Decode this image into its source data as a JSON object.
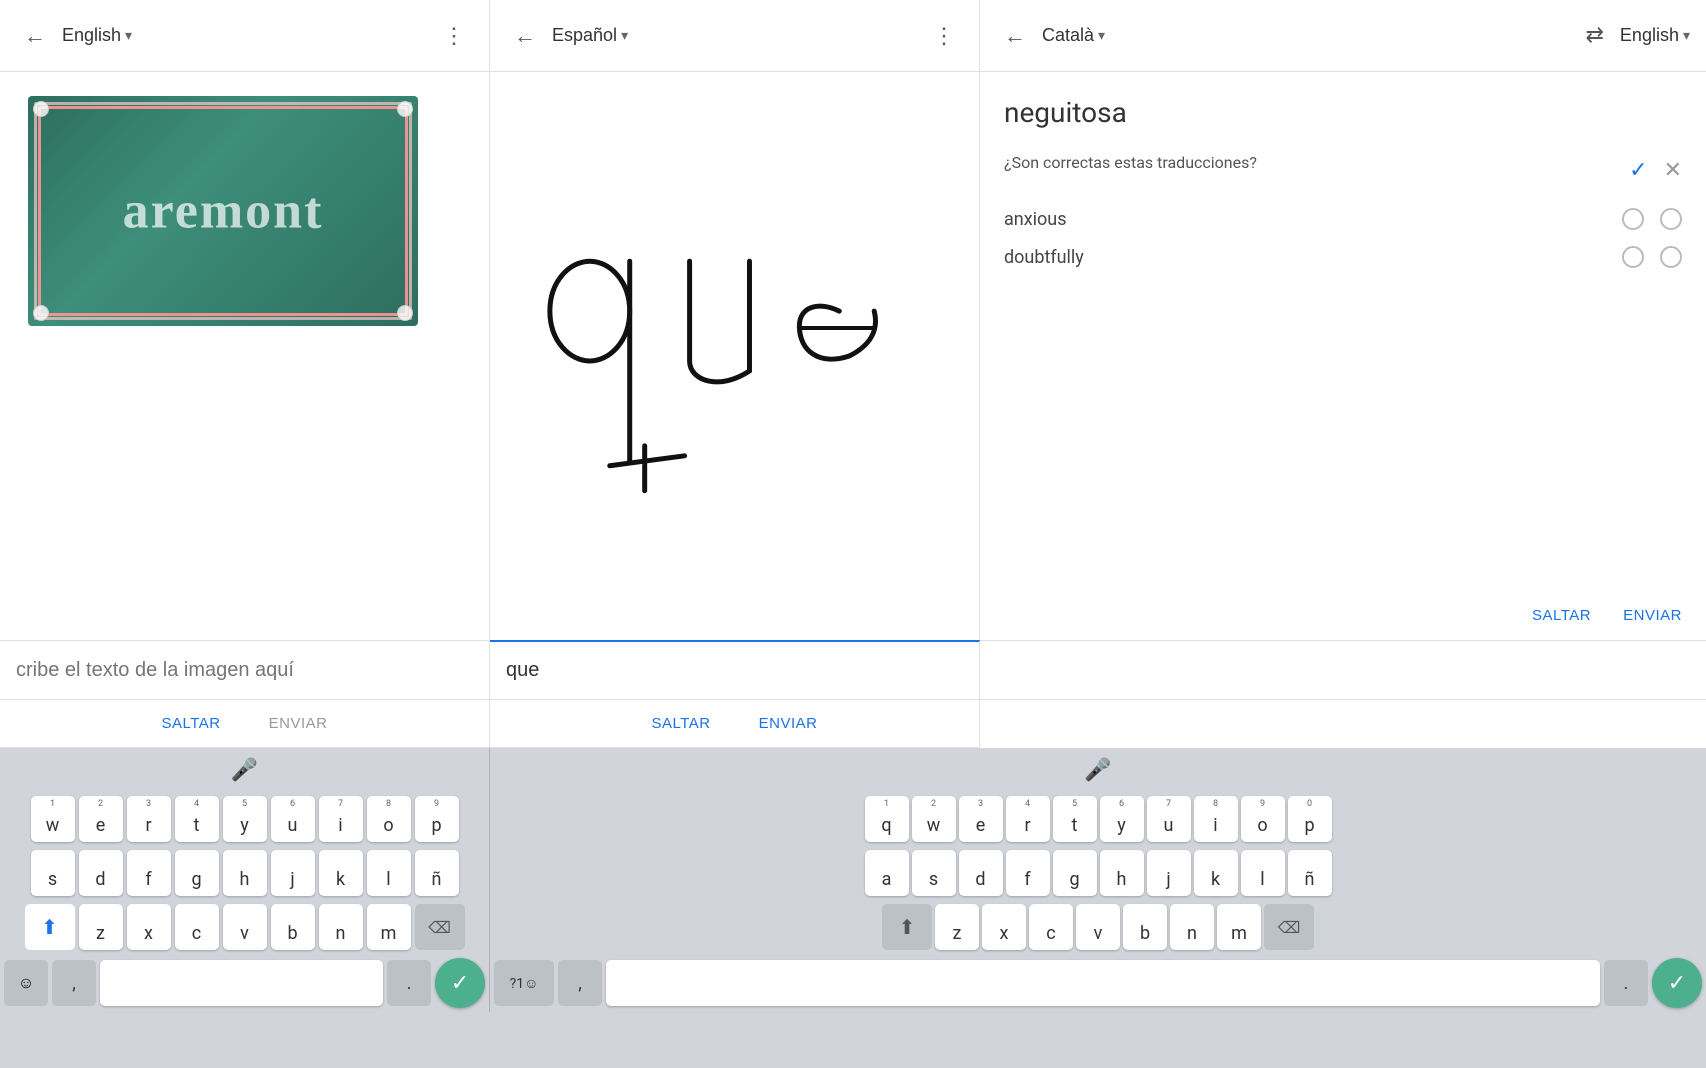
{
  "topbar": {
    "left_back_icon": "←",
    "left_lang": "English",
    "left_lang_arrow": "▾",
    "left_menu_icon": "⋮",
    "middle_back_icon": "←",
    "middle_lang": "Español",
    "middle_lang_arrow": "▾",
    "middle_menu_icon": "⋮",
    "right_back_icon": "←",
    "right_lang": "Català",
    "right_lang_arrow": "▾",
    "right_swap_icon": "⇄",
    "right_end_lang": "English",
    "right_end_lang_arrow": "▾"
  },
  "left_panel": {
    "sign_text": "aremont",
    "image_alt": "Street sign showing aremont",
    "input_placeholder": "cribe el texto de la imagen aquí",
    "skip_label": "SALTAR",
    "send_label": "ENVIAR"
  },
  "middle_panel": {
    "input_value": "que",
    "skip_label": "SALTAR",
    "send_label": "ENVIAR"
  },
  "right_panel": {
    "translation_word": "neguitosa",
    "question": "¿Son correctas estas traducciones?",
    "options": [
      {
        "label": "anxious"
      },
      {
        "label": "doubtfully"
      }
    ],
    "skip_label": "SALTAR",
    "send_label": "ENVIAR"
  },
  "keyboard": {
    "mic_icon": "🎤",
    "rows": [
      {
        "left": [
          {
            "num": "1",
            "key": "w"
          },
          {
            "num": "2",
            "key": "e"
          },
          {
            "num": "3",
            "key": "r"
          },
          {
            "num": "4",
            "key": "t"
          },
          {
            "num": "5",
            "key": "y"
          },
          {
            "num": "6",
            "key": "u"
          },
          {
            "num": "7",
            "key": "i"
          },
          {
            "num": "8",
            "key": "o"
          },
          {
            "num": "9",
            "key": "p"
          }
        ],
        "right": [
          {
            "num": "1",
            "key": "q"
          },
          {
            "num": "2",
            "key": "w"
          },
          {
            "num": "3",
            "key": "e"
          },
          {
            "num": "4",
            "key": "r"
          },
          {
            "num": "5",
            "key": "t"
          },
          {
            "num": "6",
            "key": "y"
          },
          {
            "num": "7",
            "key": "u"
          },
          {
            "num": "8",
            "key": "i"
          },
          {
            "num": "9",
            "key": "o"
          },
          {
            "num": "0",
            "key": "p"
          }
        ]
      },
      {
        "left": [
          {
            "key": "s"
          },
          {
            "key": "d"
          },
          {
            "key": "f"
          },
          {
            "key": "g"
          },
          {
            "key": "h"
          },
          {
            "key": "j"
          },
          {
            "key": "k"
          },
          {
            "key": "l"
          },
          {
            "key": "ñ"
          }
        ],
        "right": [
          {
            "key": "a"
          },
          {
            "key": "s"
          },
          {
            "key": "d"
          },
          {
            "key": "f"
          },
          {
            "key": "g"
          },
          {
            "key": "h"
          },
          {
            "key": "j"
          },
          {
            "key": "k"
          },
          {
            "key": "l"
          },
          {
            "key": "ñ"
          }
        ]
      },
      {
        "left": [
          {
            "key": "z"
          },
          {
            "key": "x"
          },
          {
            "key": "c"
          },
          {
            "key": "v"
          },
          {
            "key": "b"
          },
          {
            "key": "n"
          },
          {
            "key": "m"
          }
        ],
        "right": [
          {
            "key": "z"
          },
          {
            "key": "x"
          },
          {
            "key": "c"
          },
          {
            "key": "v"
          },
          {
            "key": "b"
          },
          {
            "key": "n"
          },
          {
            "key": "m"
          }
        ]
      }
    ],
    "bottom_left": {
      "emoji": "☺",
      "comma": ",",
      "space": "",
      "period": ".",
      "enter": "✓"
    },
    "bottom_right": {
      "numemoji": "?1☺",
      "comma": ",",
      "space": "",
      "period": ".",
      "enter": "✓"
    }
  }
}
